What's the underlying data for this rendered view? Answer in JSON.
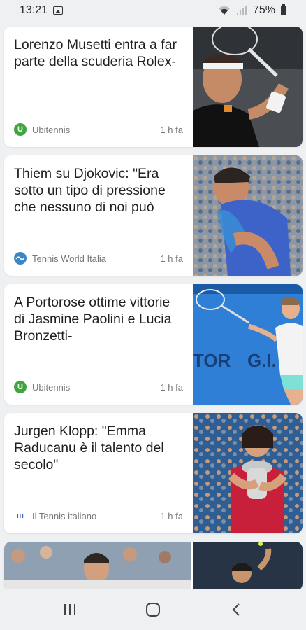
{
  "status_bar": {
    "time": "13:21",
    "battery": "75%"
  },
  "articles": [
    {
      "title": "Lorenzo Musetti entra a far parte della scuderia Rolex-",
      "source": "Ubitennis",
      "source_logo_letter": "U",
      "time": "1 h fa"
    },
    {
      "title": "Thiem su Djokovic: \"Era sotto un tipo di pressione che nessuno di noi può",
      "source": "Tennis World Italia",
      "time": "1 h fa"
    },
    {
      "title": "A Portorose ottime vittorie di Jasmine Paolini e Lucia Bronzetti-",
      "source": "Ubitennis",
      "source_logo_letter": "U",
      "time": "1 h fa"
    },
    {
      "title": "Jurgen Klopp: \"Emma Raducanu è il talento del secolo\"",
      "source": "Il Tennis italiano",
      "source_logo_text": "ITI",
      "time": "1 h fa"
    }
  ],
  "colors": {
    "background": "#eef0f2",
    "card": "#ffffff",
    "ubitennis_green": "#3ca73c",
    "tennis_world_blue": "#3a87c8"
  },
  "navigation": {
    "recent_icon": "recent-apps-icon",
    "home_icon": "home-icon",
    "back_icon": "back-icon"
  }
}
